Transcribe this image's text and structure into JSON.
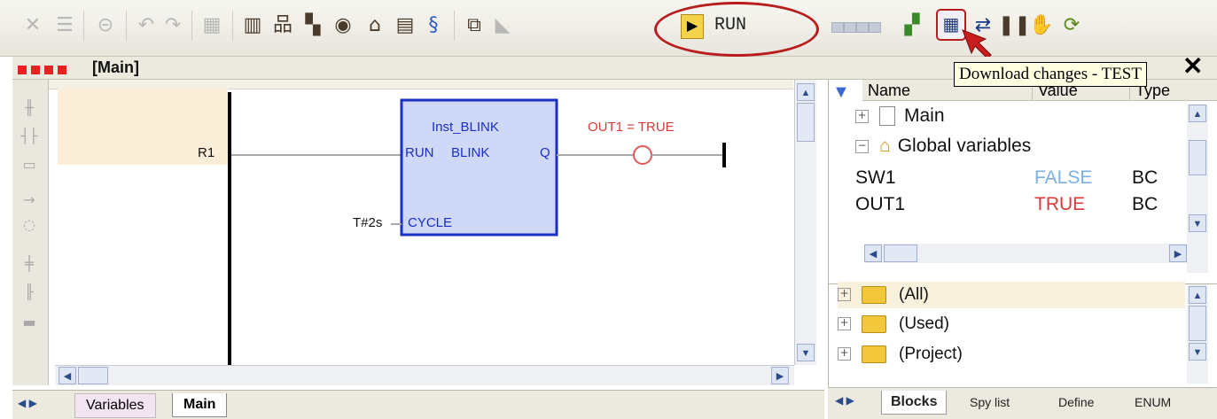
{
  "toolbar": {
    "status": "RUN",
    "tooltip": "Download changes - TEST"
  },
  "editor": {
    "title": "[Main]",
    "ladder": {
      "contact": "R1",
      "block_instance": "Inst_BLINK",
      "block_input_run": "RUN",
      "block_type": "BLINK",
      "block_output": "Q",
      "cycle_input": "CYCLE",
      "cycle_value": "T#2s",
      "coil_label": "OUT1 = TRUE"
    },
    "tabs": [
      "Variables",
      "Main"
    ]
  },
  "variables": {
    "columns": {
      "name": "Name",
      "value": "Value",
      "type": "Type"
    },
    "rows": [
      {
        "label": "Main"
      },
      {
        "label": "Global variables"
      },
      {
        "name": "SW1",
        "value": "FALSE",
        "type": "BC"
      },
      {
        "name": "OUT1",
        "value": "TRUE",
        "type": "BC"
      }
    ]
  },
  "library": {
    "folders": [
      "(All)",
      "(Used)",
      "(Project)"
    ],
    "tabs": [
      "Blocks",
      "Spy list",
      "Define",
      "ENUM"
    ]
  },
  "colors": {
    "accent_red": "#b81c1c",
    "block_fill": "#cfd8f6",
    "block_border": "#1a2fc8",
    "true_red": "#d83a3a",
    "false_blue": "#7ab0e8"
  }
}
